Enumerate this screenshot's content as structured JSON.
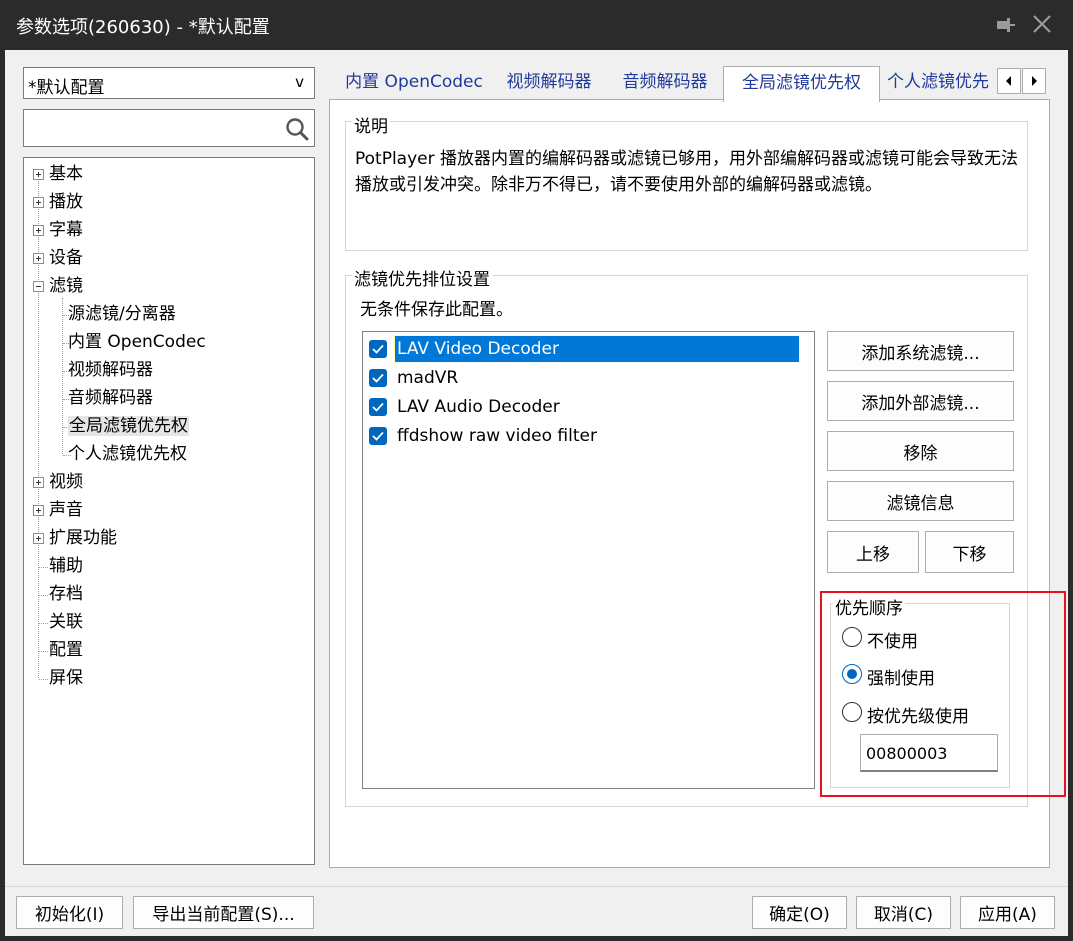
{
  "window": {
    "title": "参数选项(260630) - *默认配置"
  },
  "profile": {
    "selected": "*默认配置",
    "chevron": "v"
  },
  "search": {
    "value": "",
    "placeholder": ""
  },
  "tree": {
    "items": [
      {
        "label": "基本"
      },
      {
        "label": "播放"
      },
      {
        "label": "字幕"
      },
      {
        "label": "设备"
      },
      {
        "label": "滤镜"
      },
      {
        "label": "源滤镜/分离器"
      },
      {
        "label": "内置 OpenCodec"
      },
      {
        "label": "视频解码器"
      },
      {
        "label": "音频解码器"
      },
      {
        "label": "全局滤镜优先权"
      },
      {
        "label": "个人滤镜优先权"
      },
      {
        "label": "视频"
      },
      {
        "label": "声音"
      },
      {
        "label": "扩展功能"
      },
      {
        "label": "辅助"
      },
      {
        "label": "存档"
      },
      {
        "label": "关联"
      },
      {
        "label": "配置"
      },
      {
        "label": "屏保"
      }
    ]
  },
  "tabs": [
    {
      "label": "内置 OpenCodec"
    },
    {
      "label": "视频解码器"
    },
    {
      "label": "音频解码器"
    },
    {
      "label": "全局滤镜优先权"
    },
    {
      "label": "个人滤镜优先"
    }
  ],
  "description": {
    "title": "说明",
    "text": "PotPlayer 播放器内置的编解码器或滤镜已够用，用外部编解码器或滤镜可能会导致无法播放或引发冲突。除非万不得已，请不要使用外部的编解码器或滤镜。"
  },
  "filter_priority": {
    "title": "滤镜优先排位设置",
    "note": "无条件保存此配置。",
    "filters": [
      {
        "name": "LAV Video Decoder"
      },
      {
        "name": "madVR"
      },
      {
        "name": "LAV Audio Decoder"
      },
      {
        "name": "ffdshow raw video filter"
      }
    ],
    "buttons": {
      "add_system": "添加系统滤镜...",
      "add_external": "添加外部滤镜...",
      "remove": "移除",
      "info": "滤镜信息",
      "move_up": "上移",
      "move_down": "下移"
    }
  },
  "priority_order": {
    "title": "优先顺序",
    "options": [
      {
        "label": "不使用"
      },
      {
        "label": "强制使用"
      },
      {
        "label": "按优先级使用"
      }
    ],
    "value": "00800003"
  },
  "footer": {
    "init": "初始化(I)",
    "export": "导出当前配置(S)...",
    "ok": "确定(O)",
    "cancel": "取消(C)",
    "apply": "应用(A)"
  },
  "colors": {
    "accent": "#0078d7",
    "titlebar": "#2b2b2b",
    "tab_text": "#1f3a9a",
    "highlight": "#e81123"
  }
}
